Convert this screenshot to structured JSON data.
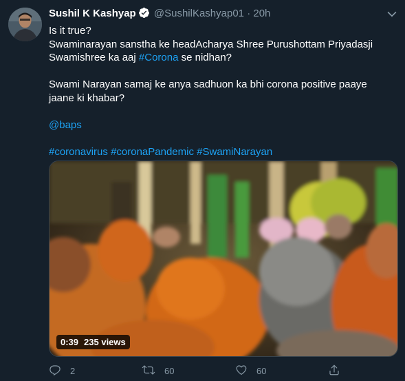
{
  "author": {
    "name": "Sushil K Kashyap",
    "handle": "@SushilKashyap01",
    "separator": "·",
    "time": "20h"
  },
  "tweet": {
    "line1": "Is it true?",
    "line2": "Swaminarayan sanstha ke headAcharya Shree Purushottam Priyadasji",
    "line3_pre": "Swamishree ka aaj ",
    "line3_tag": "#Corona",
    "line3_post": " se nidhan?",
    "line4": "Swami Narayan samaj ke anya sadhuon ka bhi corona positive paaye jaane ki khabar?",
    "mention": "@baps",
    "hashtags": [
      "#coronavirus",
      "#coronaPandemic",
      "#SwamiNarayan"
    ]
  },
  "video": {
    "duration": "0:39",
    "views": "235 views"
  },
  "actions": {
    "reply_count": "2",
    "retweet_count": "60",
    "like_count": "60"
  },
  "colors": {
    "background": "#15202b",
    "link": "#1da1f2",
    "muted": "#8899a6",
    "border": "#38444d"
  },
  "icons": [
    "verified-badge-icon",
    "chevron-down-icon",
    "reply-icon",
    "retweet-icon",
    "like-icon",
    "share-icon"
  ]
}
